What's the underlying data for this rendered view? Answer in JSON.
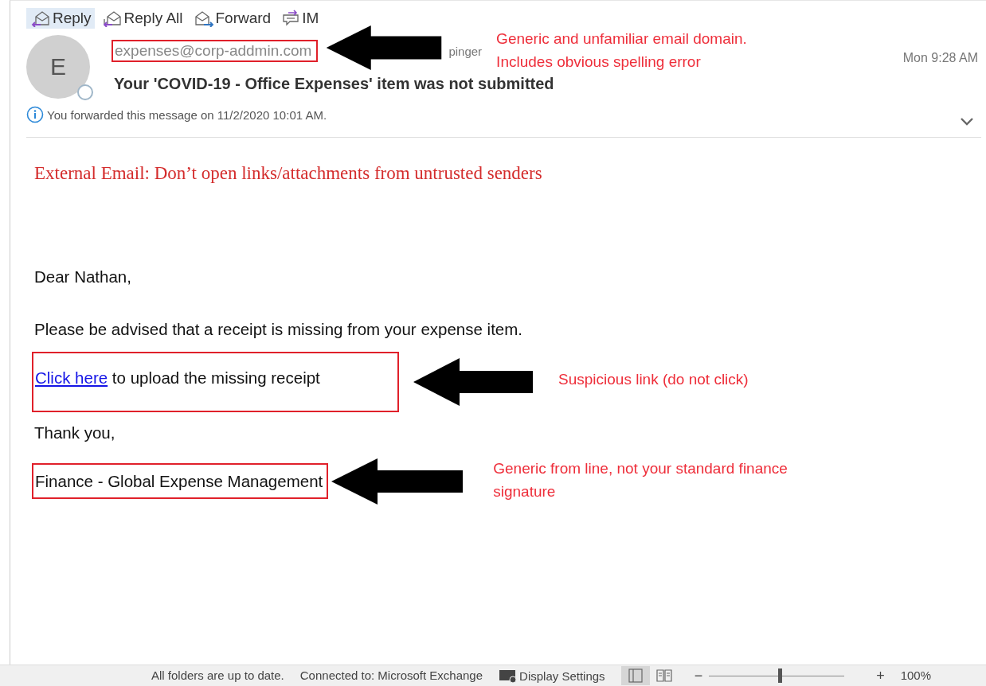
{
  "toolbar": [
    {
      "label": "Reply",
      "kind": "reply",
      "selected": true
    },
    {
      "label": "Reply All",
      "kind": "reply-all",
      "selected": false
    },
    {
      "label": "Forward",
      "kind": "forward",
      "selected": false
    },
    {
      "label": "IM",
      "kind": "im",
      "selected": false
    }
  ],
  "message": {
    "avatar_letter": "E",
    "sender": "expenses@corp-addmin.com",
    "recipient_partial": "pinger",
    "subject": "Your 'COVID-19 - Office Expenses' item was not submitted",
    "time": "Mon 9:28 AM",
    "info": "You forwarded this message on 11/2/2020 10:01 AM."
  },
  "sender_note": [
    "Generic and unfamiliar email domain.",
    "Includes obvious spelling error"
  ],
  "body": {
    "banner": "External Email: Don’t open links/attachments from untrusted senders",
    "greeting": "Dear  Nathan,",
    "line": "Please be advised that a receipt is missing from your expense item.",
    "link": "Click here",
    "link_rest": " to upload the missing receipt",
    "link_note": "Suspicious link (do not click)",
    "thanks": "Thank you,",
    "signature": "Finance - Global Expense Management",
    "signature_note": "Generic from line, not your standard finance signature"
  },
  "status_bar": {
    "sync": "All folders are up to date.",
    "connection": "Connected to: Microsoft Exchange",
    "display_settings": "Display Settings",
    "views": [
      {
        "kind": "normal",
        "selected": true
      },
      {
        "kind": "reading",
        "selected": false
      }
    ],
    "zoom": {
      "out": "−",
      "level": 0.52,
      "in": "+",
      "reading": "100%"
    }
  }
}
